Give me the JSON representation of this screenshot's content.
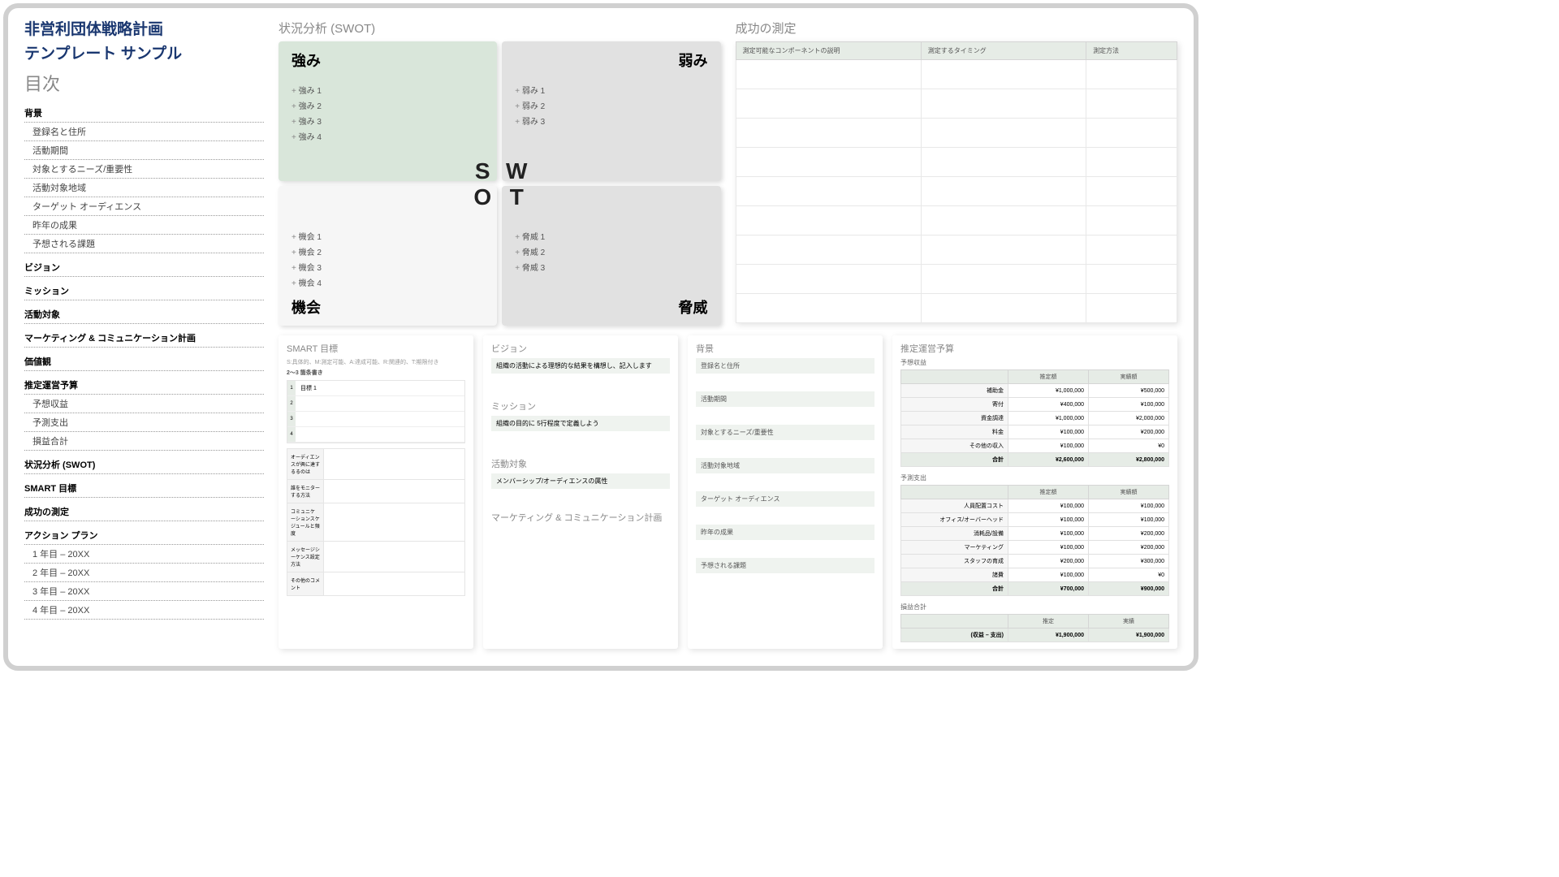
{
  "title_line1": "非営利団体戦略計画",
  "title_line2": "テンプレート サンプル",
  "toc_heading": "目次",
  "toc": [
    {
      "t": "背景",
      "l": 0
    },
    {
      "t": "登録名と住所",
      "l": 1
    },
    {
      "t": "活動期間",
      "l": 1
    },
    {
      "t": "対象とするニーズ/重要性",
      "l": 1
    },
    {
      "t": "活動対象地域",
      "l": 1
    },
    {
      "t": "ターゲット オーディエンス",
      "l": 1
    },
    {
      "t": "昨年の成果",
      "l": 1
    },
    {
      "t": "予想される課題",
      "l": 1
    },
    {
      "t": "ビジョン",
      "l": 0
    },
    {
      "t": "ミッション",
      "l": 0
    },
    {
      "t": "活動対象",
      "l": 0
    },
    {
      "t": "マーケティング & コミュニケーション計画",
      "l": 0
    },
    {
      "t": "価値観",
      "l": 0
    },
    {
      "t": "推定運営予算",
      "l": 0
    },
    {
      "t": "予想収益",
      "l": 1
    },
    {
      "t": "予測支出",
      "l": 1
    },
    {
      "t": "損益合計",
      "l": 1
    },
    {
      "t": "状況分析 (SWOT)",
      "l": 0
    },
    {
      "t": "SMART 目標",
      "l": 0
    },
    {
      "t": "成功の測定",
      "l": 0
    },
    {
      "t": "アクション プラン",
      "l": 0
    },
    {
      "t": "1 年目 – 20XX",
      "l": 1
    },
    {
      "t": "2 年目 – 20XX",
      "l": 1
    },
    {
      "t": "3 年目 – 20XX",
      "l": 1
    },
    {
      "t": "4 年目 – 20XX",
      "l": 1
    }
  ],
  "swot": {
    "heading": "状況分析 (SWOT)",
    "s": {
      "title": "強み",
      "items": [
        "強み 1",
        "強み 2",
        "強み 3",
        "強み 4"
      ],
      "letter": "S"
    },
    "w": {
      "title": "弱み",
      "items": [
        "弱み 1",
        "弱み 2",
        "弱み 3"
      ],
      "letter": "W"
    },
    "o": {
      "title": "機会",
      "items": [
        "機会 1",
        "機会 2",
        "機会 3",
        "機会 4"
      ],
      "letter": "O"
    },
    "t": {
      "title": "脅威",
      "items": [
        "脅威 1",
        "脅威 2",
        "脅威 3"
      ],
      "letter": "T"
    }
  },
  "measure": {
    "heading": "成功の測定",
    "cols": [
      "測定可能なコンポーネントの説明",
      "測定するタイミング",
      "測定方法"
    ]
  },
  "smart": {
    "heading": "SMART 目標",
    "sub": "S:具体的、M:測定可能、A:達成可能、R:関連的、T:期限付き",
    "sub2": "2～3 箇条書き",
    "goal1": "目標 1",
    "rows": [
      "オーディエンスが興に達するるのは",
      "誰をモニターする方法",
      "コミュニケーションスケジュールと頻度",
      "メッセージシーケンス設定方法",
      "その他のコメント"
    ]
  },
  "vision": {
    "heading": "ビジョン",
    "sub": "組織の活動による理想的な結果を構想し、記入します"
  },
  "mission": {
    "heading": "ミッション",
    "sub": "組織の目的に 5行程度で定義しよう"
  },
  "activity": {
    "heading": "活動対象",
    "sub": "メンバーシップ/オーディエンスの属性"
  },
  "marketing": {
    "heading": "マーケティング & コミュニケーション計画"
  },
  "background": {
    "heading": "背景",
    "items": [
      "登録名と住所",
      "活動期間",
      "対象とするニーズ/重要性",
      "活動対象地域",
      "ターゲット オーディエンス",
      "昨年の成果",
      "予想される課題"
    ]
  },
  "budget": {
    "heading": "推定運営予算",
    "rev": {
      "h": "予想収益",
      "cols": [
        "推定額",
        "実績額"
      ],
      "rows": [
        {
          "l": "補助金",
          "a": "¥1,000,000",
          "b": "¥500,000"
        },
        {
          "l": "寄付",
          "a": "¥400,000",
          "b": "¥100,000"
        },
        {
          "l": "資金調達",
          "a": "¥1,000,000",
          "b": "¥2,000,000"
        },
        {
          "l": "料金",
          "a": "¥100,000",
          "b": "¥200,000"
        },
        {
          "l": "その他の収入",
          "a": "¥100,000",
          "b": "¥0"
        }
      ],
      "total": {
        "l": "合計",
        "a": "¥2,600,000",
        "b": "¥2,800,000"
      }
    },
    "exp": {
      "h": "予測支出",
      "cols": [
        "推定額",
        "実績額"
      ],
      "rows": [
        {
          "l": "人員配置コスト",
          "a": "¥100,000",
          "b": "¥100,000"
        },
        {
          "l": "オフィス/オーバーヘッド",
          "a": "¥100,000",
          "b": "¥100,000"
        },
        {
          "l": "消耗品/設備",
          "a": "¥100,000",
          "b": "¥200,000"
        },
        {
          "l": "マーケティング",
          "a": "¥100,000",
          "b": "¥200,000"
        },
        {
          "l": "スタッフの育成",
          "a": "¥200,000",
          "b": "¥300,000"
        },
        {
          "l": "諸費",
          "a": "¥100,000",
          "b": "¥0"
        }
      ],
      "total": {
        "l": "合計",
        "a": "¥700,000",
        "b": "¥900,000"
      }
    },
    "pl": {
      "h": "損益合計",
      "cols": [
        "推定",
        "実績"
      ],
      "row": {
        "l": "(収益 – 支出)",
        "a": "¥1,900,000",
        "b": "¥1,900,000"
      }
    }
  }
}
